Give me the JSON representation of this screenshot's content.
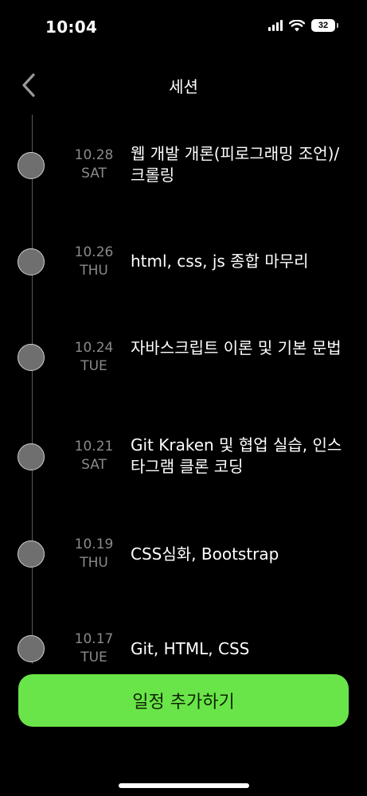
{
  "status_bar": {
    "time": "10:04",
    "battery": "32"
  },
  "header": {
    "title": "세션"
  },
  "sessions": [
    {
      "date": "10.28",
      "day": "SAT",
      "title": "웹 개발 개론(피로그래밍 조언)/크롤링"
    },
    {
      "date": "10.26",
      "day": "THU",
      "title": "html, css, js 종합 마무리"
    },
    {
      "date": "10.24",
      "day": "TUE",
      "title": "자바스크립트 이론 및 기본 문법"
    },
    {
      "date": "10.21",
      "day": "SAT",
      "title": "Git Kraken 및 협업 실습, 인스타그램 클론 코딩"
    },
    {
      "date": "10.19",
      "day": "THU",
      "title": "CSS심화, Bootstrap"
    },
    {
      "date": "10.17",
      "day": "TUE",
      "title": "Git, HTML, CSS"
    }
  ],
  "footer": {
    "add_label": "일정 추가하기"
  },
  "colors": {
    "accent": "#6ae549",
    "background": "#000000",
    "dot": "#6f6f6f",
    "date_text": "#8a8a8a"
  }
}
